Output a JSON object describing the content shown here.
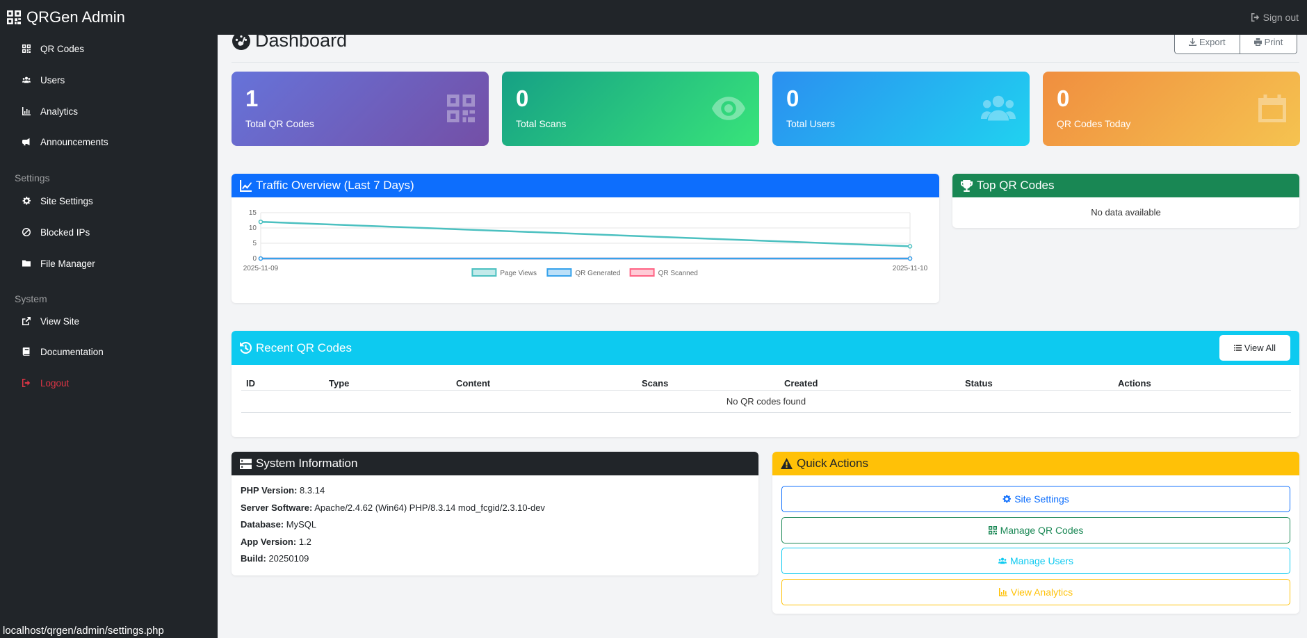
{
  "app": {
    "brand": "QRGen Admin",
    "signout": "Sign out"
  },
  "sidebar": {
    "items": [
      {
        "label": "QR Codes",
        "icon": "qrcode-icon"
      },
      {
        "label": "Users",
        "icon": "users-icon"
      },
      {
        "label": "Analytics",
        "icon": "chart-icon"
      },
      {
        "label": "Announcements",
        "icon": "megaphone-icon"
      }
    ],
    "settings_heading": "Settings",
    "settings_items": [
      {
        "label": "Site Settings",
        "icon": "gear-icon"
      },
      {
        "label": "Blocked IPs",
        "icon": "ban-icon"
      },
      {
        "label": "File Manager",
        "icon": "folder-icon"
      }
    ],
    "system_heading": "System",
    "system_items": [
      {
        "label": "View Site",
        "icon": "external-link-icon"
      },
      {
        "label": "Documentation",
        "icon": "book-icon"
      },
      {
        "label": "Logout",
        "icon": "logout-icon"
      }
    ]
  },
  "status_url": "localhost/qrgen/admin/settings.php",
  "header": {
    "title": "Dashboard",
    "export_label": "Export",
    "print_label": "Print"
  },
  "stats": [
    {
      "value": "1",
      "label": "Total QR Codes",
      "icon": "qrcode-icon",
      "gradient": [
        "#6673d9",
        "#744fa6"
      ]
    },
    {
      "value": "0",
      "label": "Total Scans",
      "icon": "eye-icon",
      "gradient": [
        "#16a085",
        "#38e47a"
      ]
    },
    {
      "value": "0",
      "label": "Total Users",
      "icon": "users-icon",
      "gradient": [
        "#2b8ff0",
        "#20d2f0"
      ]
    },
    {
      "value": "0",
      "label": "QR Codes Today",
      "icon": "calendar-icon",
      "gradient": [
        "#f08e3f",
        "#f5c350"
      ]
    }
  ],
  "traffic": {
    "title": "Traffic Overview (Last 7 Days)",
    "header_color": "#0d6efd"
  },
  "chart_data": {
    "type": "line",
    "x": [
      "2025-11-09",
      "2025-11-10"
    ],
    "ylim": [
      0,
      15
    ],
    "yticks": [
      "15",
      "10",
      "5",
      "0"
    ],
    "series": [
      {
        "name": "Page Views",
        "values": [
          12,
          4
        ],
        "color": "#4bc0c0"
      },
      {
        "name": "QR Generated",
        "values": [
          0,
          0
        ],
        "color": "#36a2eb"
      },
      {
        "name": "QR Scanned",
        "values": [
          0,
          0
        ],
        "color": "#ff6384"
      }
    ]
  },
  "top_qr": {
    "title": "Top QR Codes",
    "empty": "No data available",
    "header_color": "#198754"
  },
  "recent": {
    "title": "Recent QR Codes",
    "view_all": "View All",
    "columns": [
      "ID",
      "Type",
      "Content",
      "Scans",
      "Created",
      "Status",
      "Actions"
    ],
    "empty": "No QR codes found",
    "header_color": "#0dcaf0"
  },
  "sysinfo": {
    "title": "System Information",
    "rows": [
      {
        "key": "PHP Version:",
        "value": "8.3.14"
      },
      {
        "key": "Server Software:",
        "value": "Apache/2.4.62 (Win64) PHP/8.3.14 mod_fcgid/2.3.10-dev"
      },
      {
        "key": "Database:",
        "value": "MySQL"
      },
      {
        "key": "App Version:",
        "value": "1.2"
      },
      {
        "key": "Build:",
        "value": "20250109"
      }
    ]
  },
  "quick": {
    "title": "Quick Actions",
    "buttons": [
      {
        "label": "Site Settings",
        "icon": "gear-icon",
        "color": "#0d6efd"
      },
      {
        "label": "Manage QR Codes",
        "icon": "qrcode-icon",
        "color": "#198754"
      },
      {
        "label": "Manage Users",
        "icon": "users-icon",
        "color": "#0dcaf0"
      },
      {
        "label": "View Analytics",
        "icon": "chart-icon",
        "color": "#ffc107"
      }
    ]
  }
}
